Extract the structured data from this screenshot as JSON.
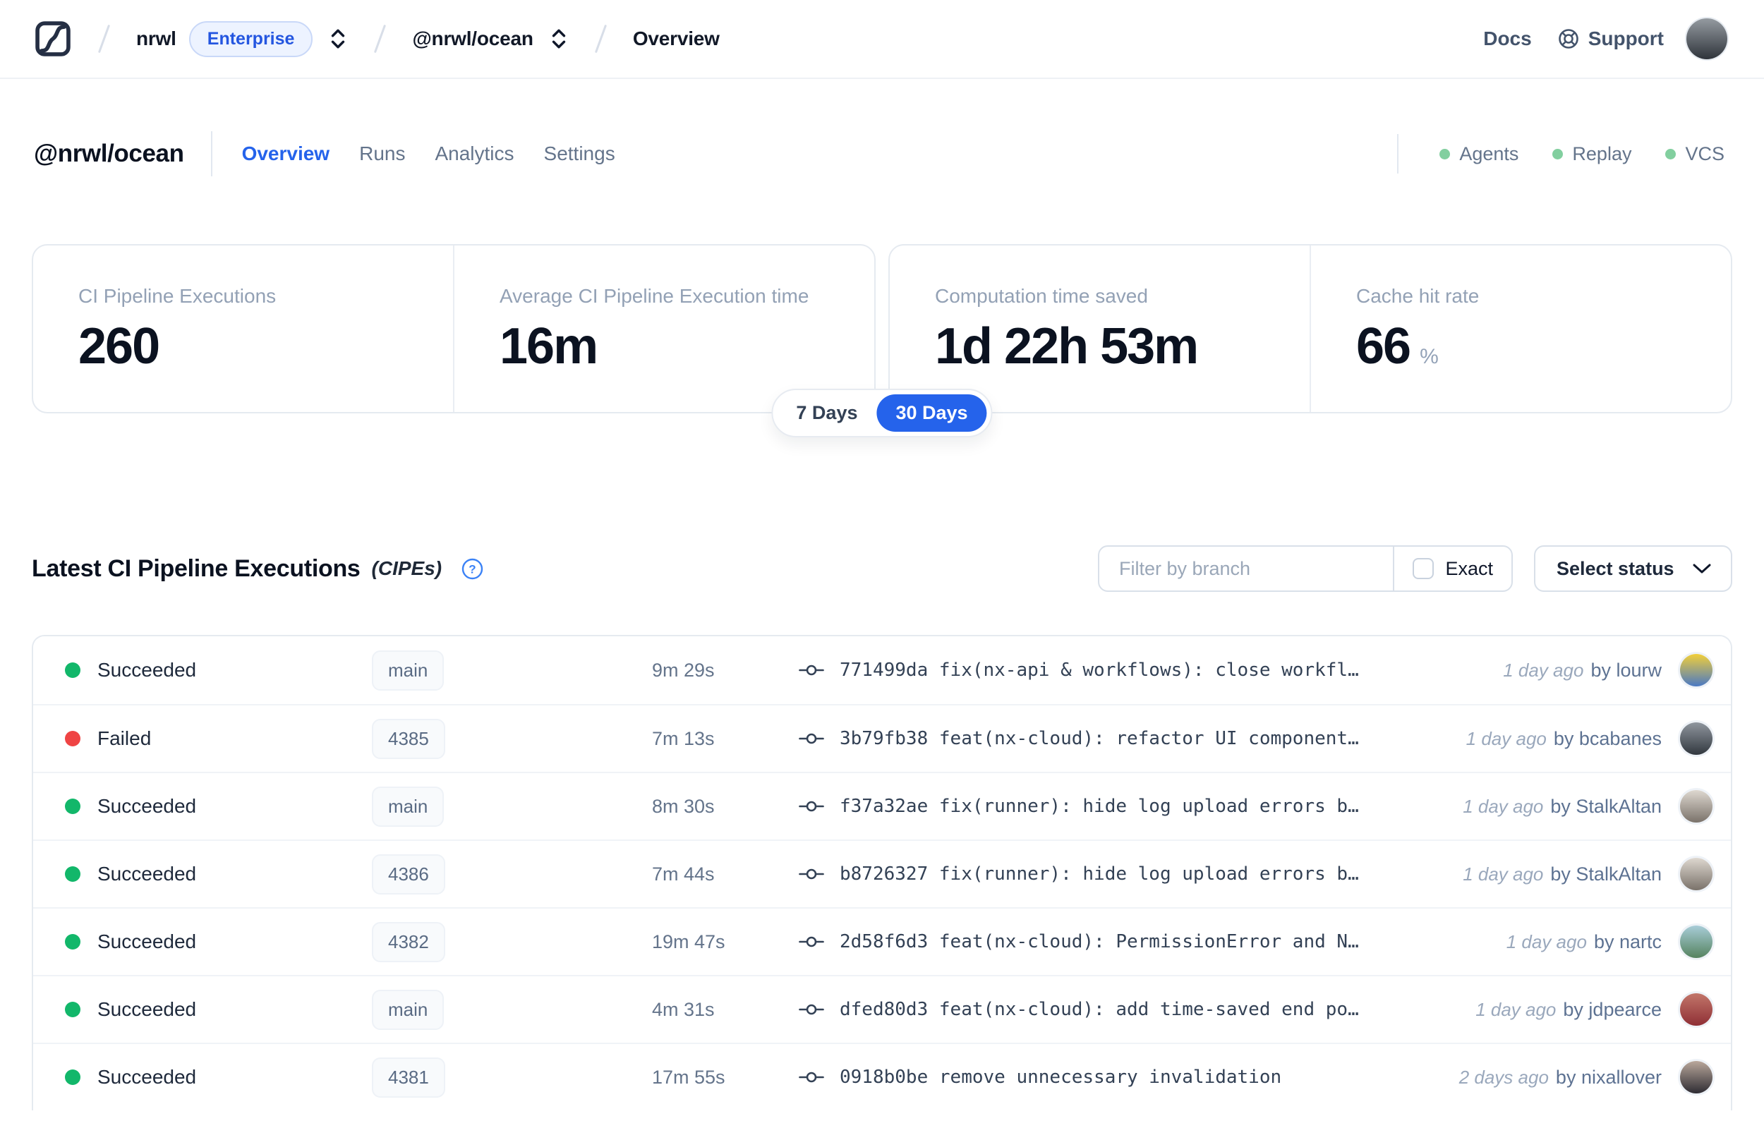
{
  "navbar": {
    "breadcrumb": {
      "org": "nrwl",
      "org_badge": "Enterprise",
      "workspace": "@nrwl/ocean",
      "page": "Overview"
    },
    "links": {
      "docs": "Docs",
      "support": "Support"
    },
    "avatar_gradient": [
      "#959ba1",
      "#2f343b"
    ]
  },
  "header": {
    "title": "@nrwl/ocean",
    "tabs": [
      {
        "label": "Overview",
        "active": true
      },
      {
        "label": "Runs",
        "active": false
      },
      {
        "label": "Analytics",
        "active": false
      },
      {
        "label": "Settings",
        "active": false
      }
    ],
    "integrations": [
      {
        "label": "Agents"
      },
      {
        "label": "Replay"
      },
      {
        "label": "VCS"
      }
    ]
  },
  "stats": {
    "cards": [
      {
        "label": "CI Pipeline Executions",
        "value": "260",
        "suffix": ""
      },
      {
        "label": "Average CI Pipeline Execution time",
        "value": "16m",
        "suffix": ""
      },
      {
        "label": "Computation time saved",
        "value": "1d 22h 53m",
        "suffix": ""
      },
      {
        "label": "Cache hit rate",
        "value": "66",
        "suffix": "%"
      }
    ],
    "range_toggle": {
      "options": [
        "7 Days",
        "30 Days"
      ],
      "selected": "30 Days"
    }
  },
  "cipe_section": {
    "title": "Latest CI Pipeline Executions",
    "title_suffix": "(CIPEs)",
    "filter": {
      "placeholder": "Filter by branch",
      "exact_label": "Exact",
      "exact_checked": false,
      "status_button": "Select status"
    },
    "rows": [
      {
        "status": "Succeeded",
        "status_color": "#12b76a",
        "branch": "main",
        "duration": "9m 29s",
        "commit": "771499da",
        "message": "fix(nx-api & workflows): close workfl…",
        "time": "1 day ago",
        "author": "by lourw",
        "avatar_gradient": [
          "#f2cf3a",
          "#4a79c4"
        ]
      },
      {
        "status": "Failed",
        "status_color": "#ef4444",
        "branch": "4385",
        "duration": "7m 13s",
        "commit": "3b79fb38",
        "message": "feat(nx-cloud): refactor UI component…",
        "time": "1 day ago",
        "author": "by bcabanes",
        "avatar_gradient": [
          "#8f969e",
          "#32383f"
        ]
      },
      {
        "status": "Succeeded",
        "status_color": "#12b76a",
        "branch": "main",
        "duration": "8m 30s",
        "commit": "f37a32ae",
        "message": "fix(runner): hide log upload errors b…",
        "time": "1 day ago",
        "author": "by StalkAltan",
        "avatar_gradient": [
          "#ded8d0",
          "#7a726a"
        ]
      },
      {
        "status": "Succeeded",
        "status_color": "#12b76a",
        "branch": "4386",
        "duration": "7m 44s",
        "commit": "b8726327",
        "message": "fix(runner): hide log upload errors b…",
        "time": "1 day ago",
        "author": "by StalkAltan",
        "avatar_gradient": [
          "#ded8d0",
          "#7a726a"
        ]
      },
      {
        "status": "Succeeded",
        "status_color": "#12b76a",
        "branch": "4382",
        "duration": "19m 47s",
        "commit": "2d58f6d3",
        "message": "feat(nx-cloud): PermissionError and N…",
        "time": "1 day ago",
        "author": "by nartc",
        "avatar_gradient": [
          "#a8cdd8",
          "#55835f"
        ]
      },
      {
        "status": "Succeeded",
        "status_color": "#12b76a",
        "branch": "main",
        "duration": "4m 31s",
        "commit": "dfed80d3",
        "message": "feat(nx-cloud): add time-saved end po…",
        "time": "1 day ago",
        "author": "by jdpearce",
        "avatar_gradient": [
          "#c2766a",
          "#8f2f35"
        ]
      },
      {
        "status": "Succeeded",
        "status_color": "#12b76a",
        "branch": "4381",
        "duration": "17m 55s",
        "commit": "0918b0be",
        "message": "remove unnecessary invalidation",
        "time": "2 days ago",
        "author": "by nixallover",
        "avatar_gradient": [
          "#b9a79b",
          "#2e2c33"
        ]
      }
    ]
  },
  "icons": {
    "logo": "nx-cloud-logo",
    "breadcrumb_selector": "chevrons-up-down",
    "support": "lifebuoy",
    "help": "question-circle",
    "status_chevron": "chevron-down",
    "commit": "git-commit"
  },
  "colors": {
    "accent": "#2563eb",
    "success": "#12b76a",
    "danger": "#ef4444",
    "integration_dot": "#82cf9f",
    "border": "#e5eaf0"
  }
}
